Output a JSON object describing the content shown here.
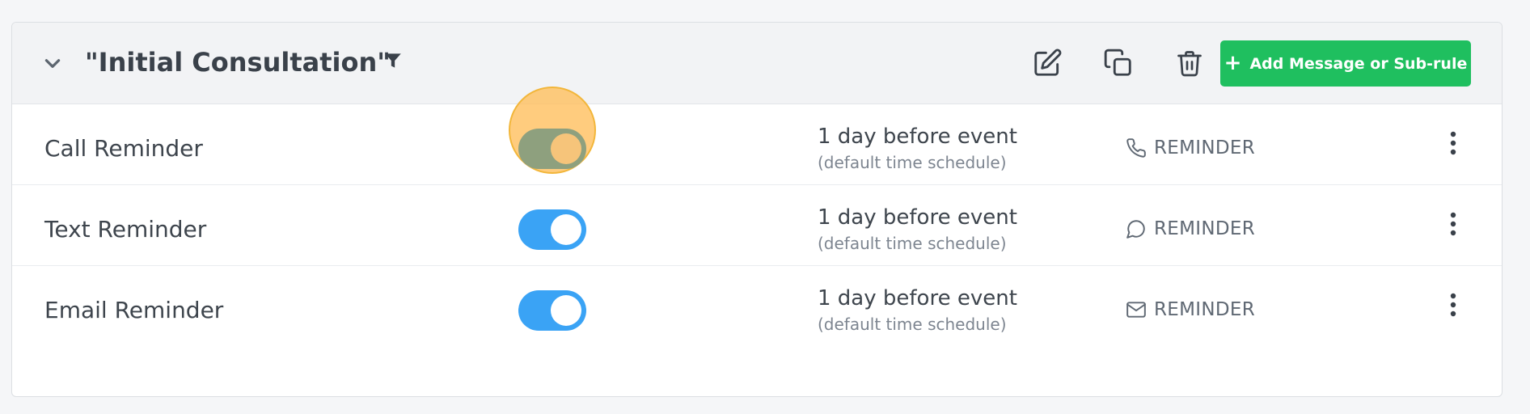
{
  "rule": {
    "title": "\"Initial Consultation\"",
    "add_button_label": "Add Message or Sub-rule",
    "icons": {
      "collapse": "chevron-down-icon",
      "filter": "filter-icon",
      "edit": "edit-icon",
      "copy": "copy-icon",
      "delete": "trash-icon",
      "add": "plus-icon"
    }
  },
  "colors": {
    "accent_green": "#1fbf5f",
    "toggle_on": "#3aa3f5",
    "highlight": "#f8c56f"
  },
  "messages": [
    {
      "name": "Call Reminder",
      "enabled": true,
      "highlighted": true,
      "schedule": "1 day before event",
      "schedule_note": "(default time schedule)",
      "channel_icon": "phone-icon",
      "channel_label": "REMINDER"
    },
    {
      "name": "Text Reminder",
      "enabled": true,
      "highlighted": false,
      "schedule": "1 day before event",
      "schedule_note": "(default time schedule)",
      "channel_icon": "chat-bubble-icon",
      "channel_label": "REMINDER"
    },
    {
      "name": "Email Reminder",
      "enabled": true,
      "highlighted": false,
      "schedule": "1 day before event",
      "schedule_note": "(default time schedule)",
      "channel_icon": "mail-icon",
      "channel_label": "REMINDER"
    }
  ]
}
